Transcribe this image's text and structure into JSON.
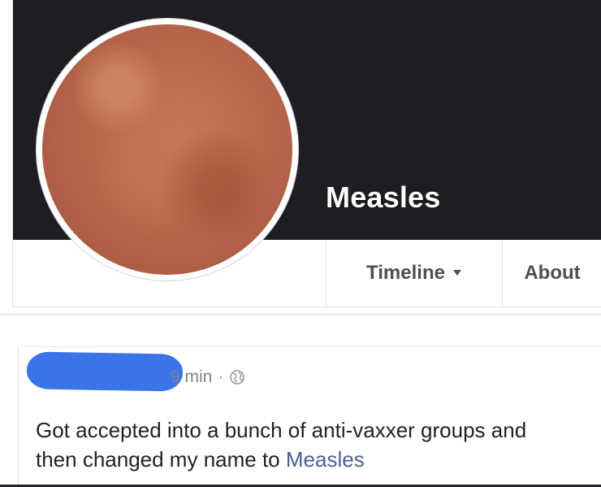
{
  "profile": {
    "name": "Measles"
  },
  "tabs": [
    {
      "label": "Timeline",
      "has_dropdown": true
    },
    {
      "label": "About",
      "has_dropdown": false
    }
  ],
  "post": {
    "time": "9 min",
    "separator": "·",
    "audience_icon": "globe-icon",
    "text_before": "Got accepted into a bunch of anti-vaxxer groups and then changed my name to ",
    "text_link": "Measles"
  },
  "colors": {
    "cover": "#1d1e22",
    "tab_text": "#4b4f56",
    "link": "#4a5f94",
    "redaction": "#3a74e8"
  }
}
